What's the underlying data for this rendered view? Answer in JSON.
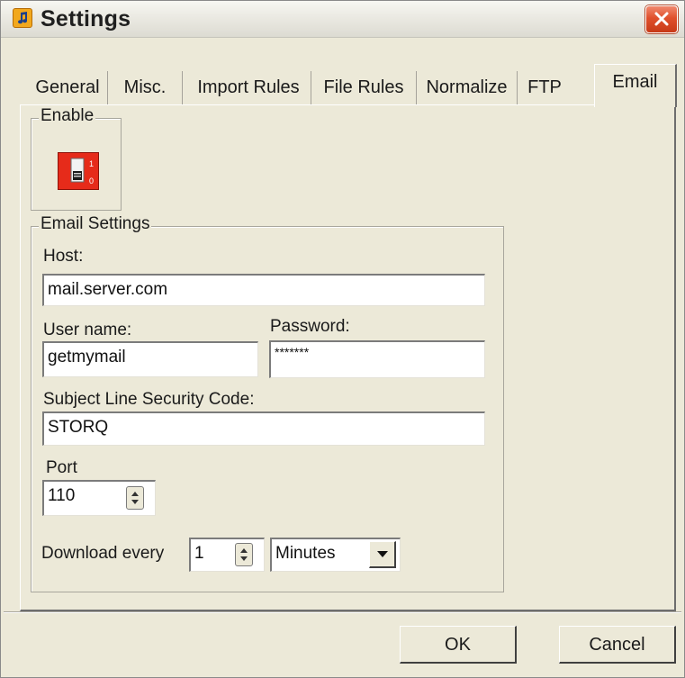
{
  "window": {
    "title": "Settings",
    "icon": "music-note-icon",
    "close_icon": "close-icon",
    "accent_close": "#d94422",
    "background": "#ece9d8"
  },
  "tabs": [
    {
      "label": "General",
      "active": false
    },
    {
      "label": "Misc.",
      "active": false
    },
    {
      "label": "Import Rules",
      "active": false
    },
    {
      "label": "File Rules",
      "active": false
    },
    {
      "label": "Normalize",
      "active": false
    },
    {
      "label": "FTP",
      "active": false
    },
    {
      "label": "Email",
      "active": true
    }
  ],
  "enable_group": {
    "legend": "Enable",
    "toggle_icon": "enable-toggle-icon",
    "toggle_color": "#e62b1a"
  },
  "email_settings": {
    "legend": "Email Settings",
    "host_label": "Host:",
    "host_value": "mail.server.com",
    "username_label": "User name:",
    "username_value": "getmymail",
    "password_label": "Password:",
    "password_value": "*******",
    "security_label": "Subject Line Security Code:",
    "security_value": "STORQ",
    "port_label": "Port",
    "port_value": "110",
    "download_label": "Download every",
    "download_value": "1",
    "interval_value": "Minutes"
  },
  "buttons": {
    "ok": "OK",
    "cancel": "Cancel"
  }
}
